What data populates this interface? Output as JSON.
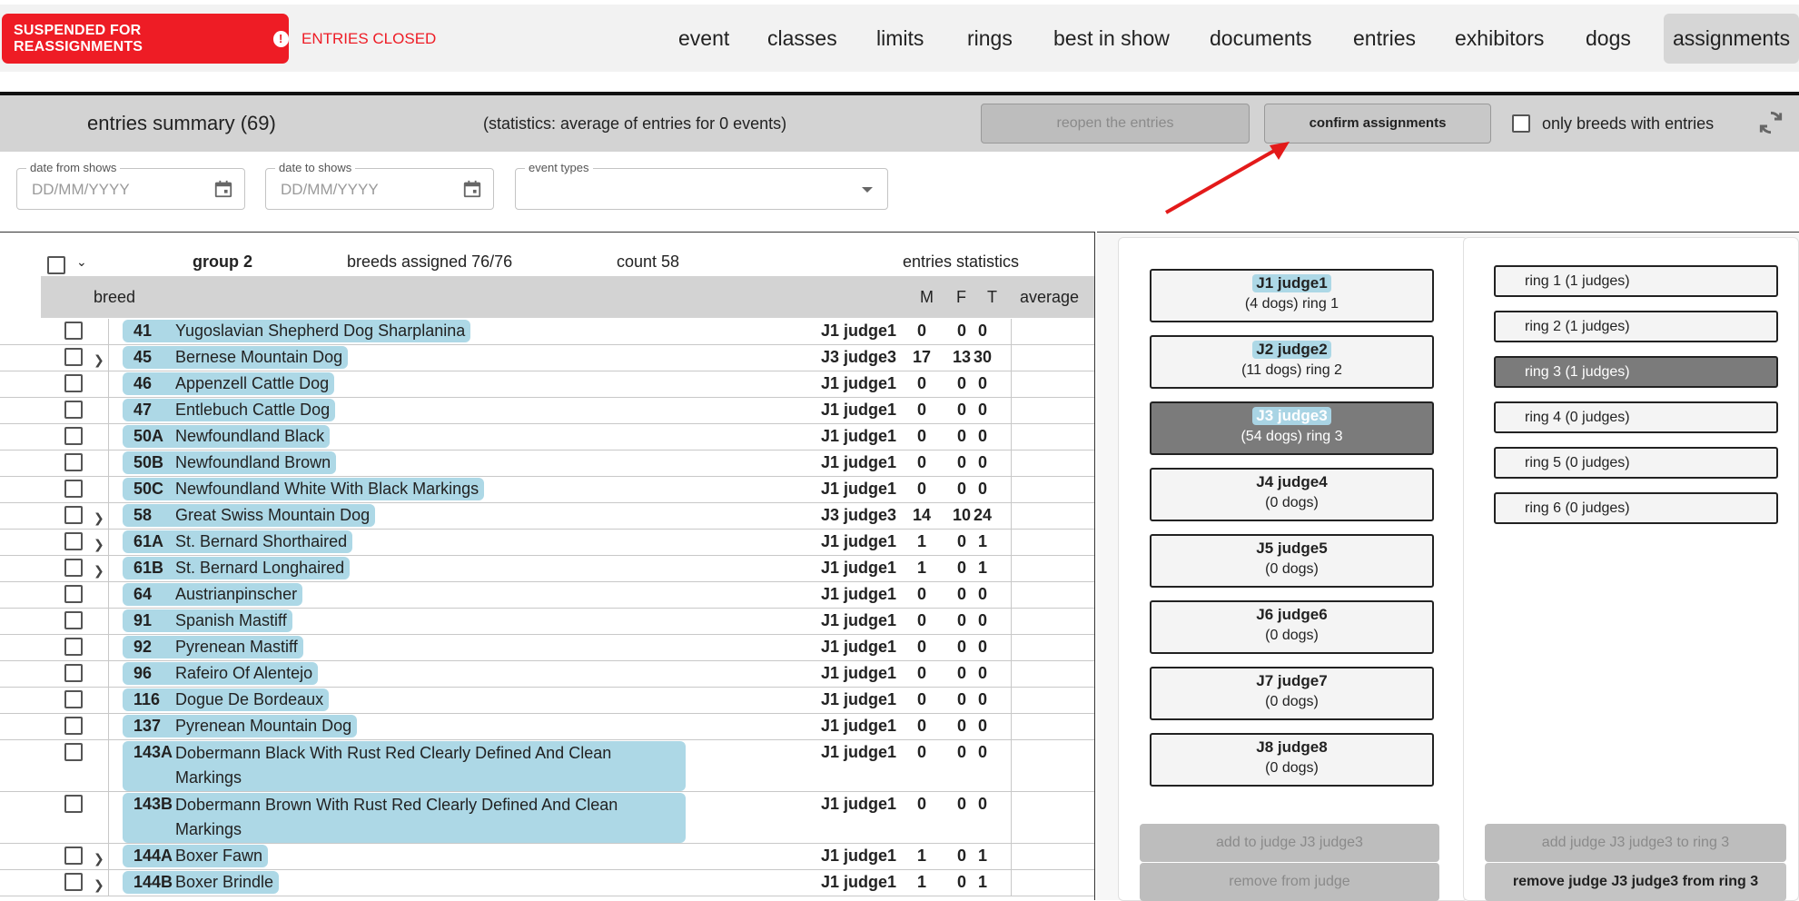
{
  "header": {
    "status_badge": "SUSPENDED FOR REASSIGNMENTS",
    "status_icon": "!",
    "entries_status": "ENTRIES CLOSED",
    "nav": [
      "event",
      "classes",
      "limits",
      "rings",
      "best in show",
      "documents",
      "entries",
      "exhibitors",
      "dogs",
      "assignments"
    ],
    "active_nav": "assignments"
  },
  "summary": {
    "title": "entries summary (69)",
    "stats": "(statistics: average of entries for 0 events)",
    "reopen_label": "reopen the entries",
    "confirm_label": "confirm assignments",
    "only_breeds_label": "only breeds with entries"
  },
  "filters": {
    "date_from_label": "date from shows",
    "date_from_placeholder": "DD/MM/YYYY",
    "date_to_label": "date to shows",
    "date_to_placeholder": "DD/MM/YYYY",
    "event_types_label": "event types",
    "event_types_value": ""
  },
  "table": {
    "group": "group 2",
    "breeds_assigned": "breeds assigned 76/76",
    "count": "count 58",
    "entries_statistics": "entries statistics",
    "col_breed": "breed",
    "col_m": "M",
    "col_f": "F",
    "col_t": "T",
    "col_average": "average",
    "rows": [
      {
        "code": "41",
        "breed": "Yugoslavian Shepherd Dog Sharplanina",
        "judge": "J1 judge1",
        "m": "0",
        "f": "0",
        "t": "0",
        "expand": false
      },
      {
        "code": "45",
        "breed": "Bernese Mountain Dog",
        "judge": "J3 judge3",
        "m": "17",
        "f": "13",
        "t": "30",
        "expand": true
      },
      {
        "code": "46",
        "breed": "Appenzell Cattle Dog",
        "judge": "J1 judge1",
        "m": "0",
        "f": "0",
        "t": "0",
        "expand": false
      },
      {
        "code": "47",
        "breed": "Entlebuch Cattle Dog",
        "judge": "J1 judge1",
        "m": "0",
        "f": "0",
        "t": "0",
        "expand": false
      },
      {
        "code": "50A",
        "breed": "Newfoundland Black",
        "judge": "J1 judge1",
        "m": "0",
        "f": "0",
        "t": "0",
        "expand": false
      },
      {
        "code": "50B",
        "breed": "Newfoundland Brown",
        "judge": "J1 judge1",
        "m": "0",
        "f": "0",
        "t": "0",
        "expand": false
      },
      {
        "code": "50C",
        "breed": "Newfoundland White With Black Markings",
        "judge": "J1 judge1",
        "m": "0",
        "f": "0",
        "t": "0",
        "expand": false
      },
      {
        "code": "58",
        "breed": "Great Swiss Mountain Dog",
        "judge": "J3 judge3",
        "m": "14",
        "f": "10",
        "t": "24",
        "expand": true
      },
      {
        "code": "61A",
        "breed": "St. Bernard Shorthaired",
        "judge": "J1 judge1",
        "m": "1",
        "f": "0",
        "t": "1",
        "expand": true
      },
      {
        "code": "61B",
        "breed": "St. Bernard Longhaired",
        "judge": "J1 judge1",
        "m": "1",
        "f": "0",
        "t": "1",
        "expand": true
      },
      {
        "code": "64",
        "breed": "Austrianpinscher",
        "judge": "J1 judge1",
        "m": "0",
        "f": "0",
        "t": "0",
        "expand": false
      },
      {
        "code": "91",
        "breed": "Spanish Mastiff",
        "judge": "J1 judge1",
        "m": "0",
        "f": "0",
        "t": "0",
        "expand": false
      },
      {
        "code": "92",
        "breed": "Pyrenean Mastiff",
        "judge": "J1 judge1",
        "m": "0",
        "f": "0",
        "t": "0",
        "expand": false
      },
      {
        "code": "96",
        "breed": "Rafeiro Of Alentejo",
        "judge": "J1 judge1",
        "m": "0",
        "f": "0",
        "t": "0",
        "expand": false
      },
      {
        "code": "116",
        "breed": "Dogue De Bordeaux",
        "judge": "J1 judge1",
        "m": "0",
        "f": "0",
        "t": "0",
        "expand": false
      },
      {
        "code": "137",
        "breed": "Pyrenean Mountain Dog",
        "judge": "J1 judge1",
        "m": "0",
        "f": "0",
        "t": "0",
        "expand": false
      },
      {
        "code": "143A",
        "breed": "Dobermann Black With Rust Red Clearly Defined And Clean Markings",
        "judge": "J1 judge1",
        "m": "0",
        "f": "0",
        "t": "0",
        "expand": false
      },
      {
        "code": "143B",
        "breed": "Dobermann Brown With Rust Red Clearly Defined And Clean Markings",
        "judge": "J1 judge1",
        "m": "0",
        "f": "0",
        "t": "0",
        "expand": false
      },
      {
        "code": "144A",
        "breed": "Boxer Fawn",
        "judge": "J1 judge1",
        "m": "1",
        "f": "0",
        "t": "1",
        "expand": true
      },
      {
        "code": "144B",
        "breed": "Boxer Brindle",
        "judge": "J1 judge1",
        "m": "1",
        "f": "0",
        "t": "1",
        "expand": true
      }
    ]
  },
  "judges": [
    {
      "name": "J1 judge1",
      "sub": "(4 dogs) ring 1",
      "highlight": true,
      "selected": false
    },
    {
      "name": "J2 judge2",
      "sub": "(11 dogs) ring 2",
      "highlight": true,
      "selected": false
    },
    {
      "name": "J3 judge3",
      "sub": "(54 dogs) ring 3",
      "highlight": true,
      "selected": true
    },
    {
      "name": "J4 judge4",
      "sub": "(0 dogs)",
      "highlight": false,
      "selected": false
    },
    {
      "name": "J5 judge5",
      "sub": "(0 dogs)",
      "highlight": false,
      "selected": false
    },
    {
      "name": "J6 judge6",
      "sub": "(0 dogs)",
      "highlight": false,
      "selected": false
    },
    {
      "name": "J7 judge7",
      "sub": "(0 dogs)",
      "highlight": false,
      "selected": false
    },
    {
      "name": "J8 judge8",
      "sub": "(0 dogs)",
      "highlight": false,
      "selected": false
    }
  ],
  "rings": [
    {
      "label": "ring 1 (1 judges)",
      "selected": false
    },
    {
      "label": "ring 2 (1 judges)",
      "selected": false
    },
    {
      "label": "ring 3 (1 judges)",
      "selected": true
    },
    {
      "label": "ring 4 (0 judges)",
      "selected": false
    },
    {
      "label": "ring 5 (0 judges)",
      "selected": false
    },
    {
      "label": "ring 6 (0 judges)",
      "selected": false
    }
  ],
  "actions": {
    "add_to_judge": "add to judge J3 judge3",
    "remove_from_judge": "remove from judge",
    "add_judge_to_ring": "add judge J3 judge3 to ring 3",
    "remove_judge_from_ring": "remove judge J3 judge3 from ring 3"
  },
  "colors": {
    "alert_red": "#ee1c25",
    "breed_highlight": "#add8e6",
    "selected_card": "#7b7b7b"
  }
}
